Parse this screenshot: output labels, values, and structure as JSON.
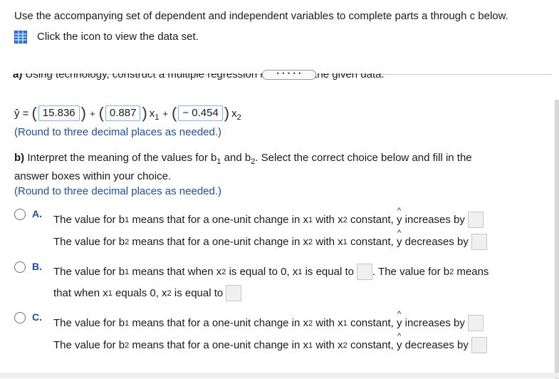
{
  "intro": "Use the accompanying set of dependent and independent variables to complete parts a through c below.",
  "data_link": "Click the icon to view the data set.",
  "expand_button": "• • • • •",
  "part_a": {
    "label": "a)",
    "text": "Using technology, construct a multiple regression model with the given data.",
    "yhat_prefix": "ŷ =",
    "b0": "15.836",
    "plus1": "+",
    "b1": "0.887",
    "x1": "x",
    "plus2": "+",
    "b2": "− 0.454",
    "x2": "x",
    "sub1": "1",
    "sub2": "2",
    "round": "(Round to three decimal places as needed.)"
  },
  "part_b": {
    "label": "b)",
    "text1": "Interpret the meaning of the values for b",
    "and": "and b",
    "text2": ". Select the correct choice below and fill in the",
    "line2": "answer boxes within your choice.",
    "round": "(Round to three decimal places as needed.)"
  },
  "options": {
    "a": {
      "letter": "A.",
      "l1_start": "The value for b",
      "l1_mid": "means that for a one-unit change in x",
      "l1_with": "with x",
      "l1_end": "constant,",
      "l1_yhat": "y",
      "l1_tail": "increases by",
      "l2_start": "The value for b",
      "l2_mid": "means that for a one-unit change in x",
      "l2_with": "with x",
      "l2_end": "constant,",
      "l2_yhat": "y",
      "l2_tail": "decreases by"
    },
    "b": {
      "letter": "B.",
      "l1_start": "The value for b",
      "l1_mid": "means that when x",
      "l1_equal": "is equal to 0, x",
      "l1_eq2": "is equal to",
      "l1_tail": ". The value for b",
      "l1_means": "means",
      "l2_start": "that when x",
      "l2_mid": "equals 0, x",
      "l2_tail": "is equal to"
    },
    "c": {
      "letter": "C.",
      "l1_start": "The value for b",
      "l1_mid": "means that for a one-unit change in x",
      "l1_with": "with x",
      "l1_end": "constant,",
      "l1_yhat": "y",
      "l1_tail": "increases by",
      "l2_start": "The value for b",
      "l2_mid": "means that for a one-unit change in x",
      "l2_with": "with x",
      "l2_end": "constant,",
      "l2_yhat": "y",
      "l2_tail": "decreases by"
    }
  },
  "colors": {
    "accent": "#1f4e9a",
    "box_border": "#8ab3e0"
  },
  "icons": {
    "data": "spreadsheet-grid-icon"
  }
}
